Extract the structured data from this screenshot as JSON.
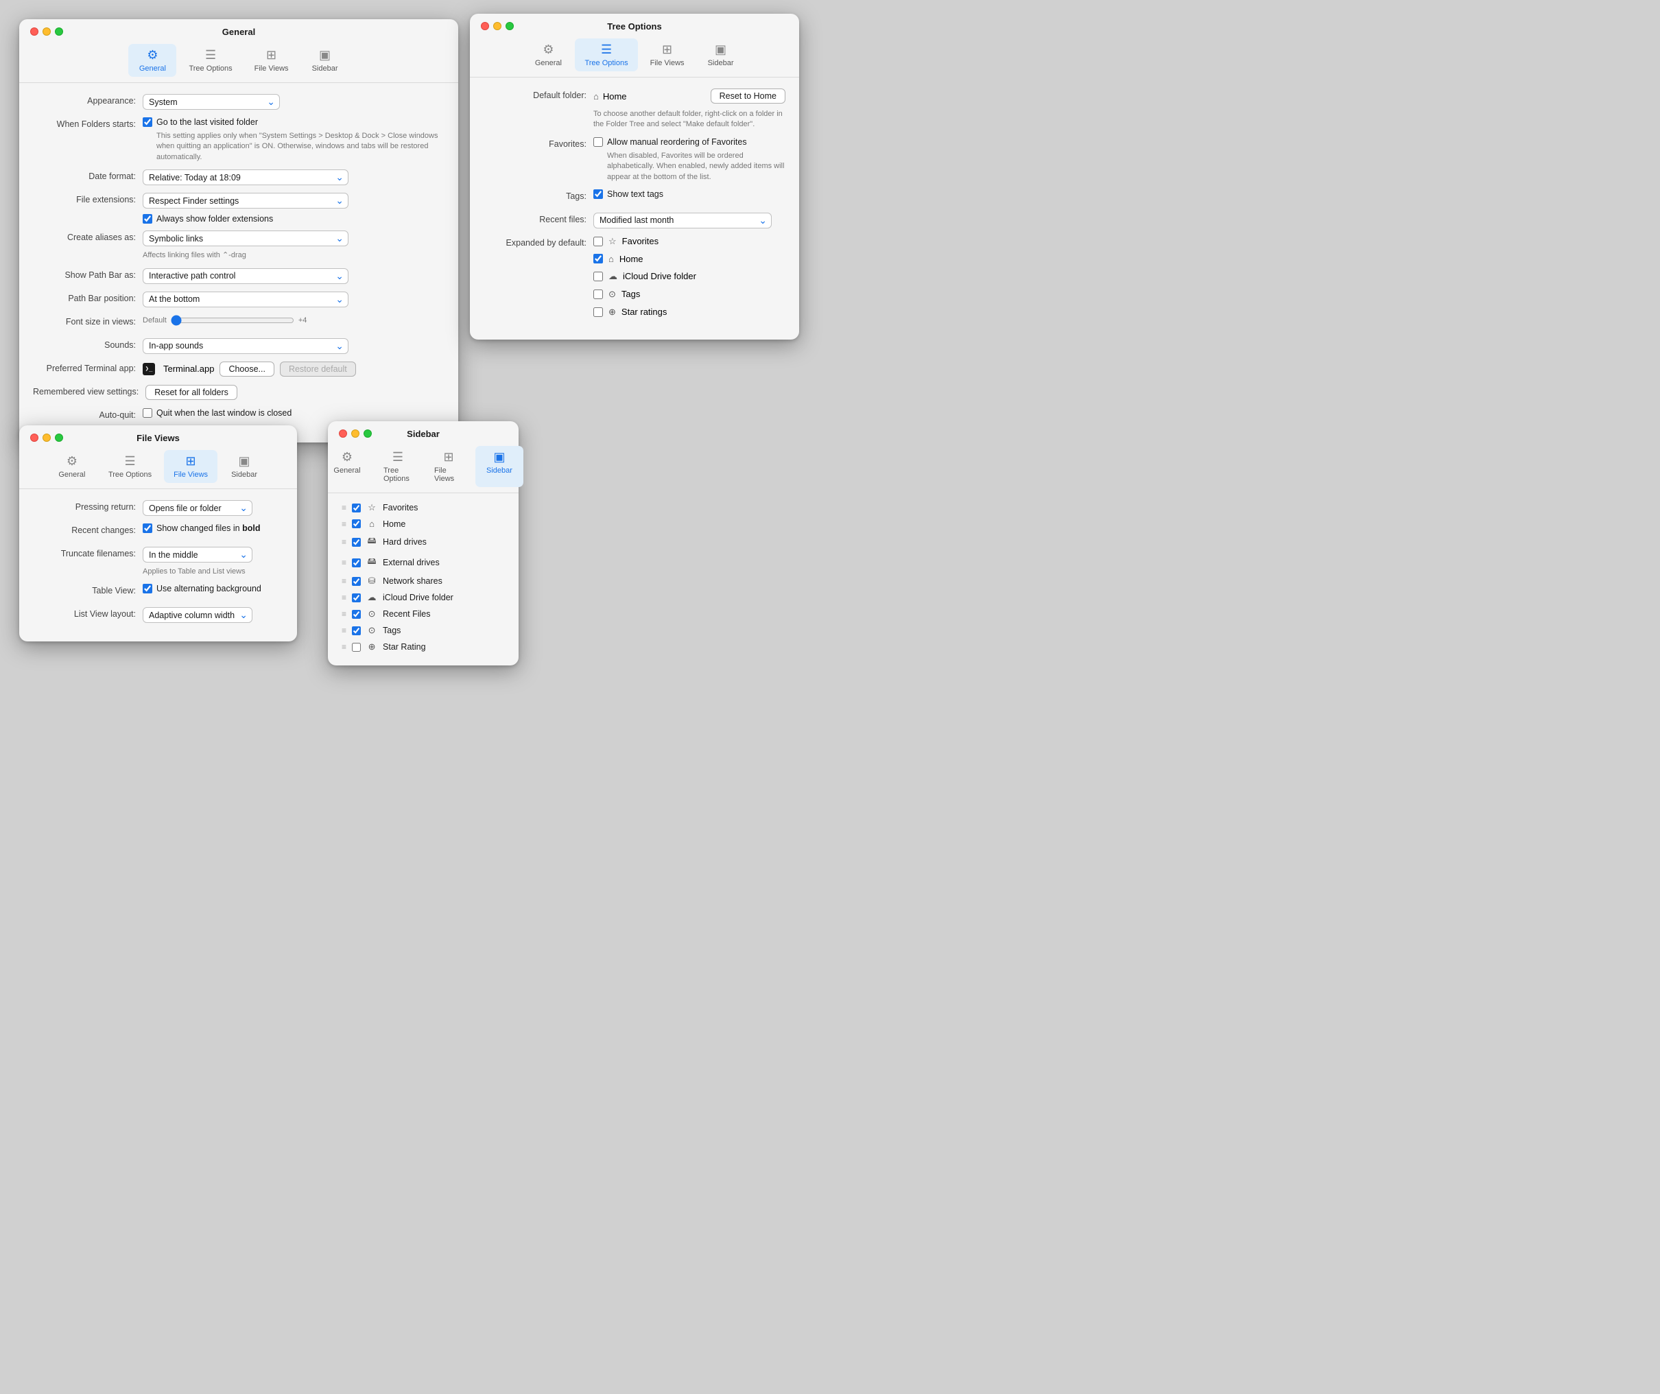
{
  "windows": {
    "general": {
      "title": "General",
      "tabs": [
        {
          "id": "general",
          "label": "General",
          "icon": "⚙️",
          "active": true
        },
        {
          "id": "tree",
          "label": "Tree Options",
          "icon": "≡",
          "active": false
        },
        {
          "id": "fileviews",
          "label": "File Views",
          "icon": "⊞",
          "active": false
        },
        {
          "id": "sidebar",
          "label": "Sidebar",
          "icon": "▣",
          "active": false
        }
      ],
      "fields": {
        "appearance_label": "Appearance:",
        "appearance_value": "System",
        "when_folders_label": "When Folders starts:",
        "when_folders_check": true,
        "when_folders_text": "Go to the last visited folder",
        "when_folders_help": "This setting applies only when \"System Settings > Desktop & Dock > Close windows when quitting an application\" is ON. Otherwise, windows and tabs will be restored automatically.",
        "date_format_label": "Date format:",
        "date_format_value": "Relative: Today at 18:09",
        "file_ext_label": "File extensions:",
        "file_ext_value": "Respect Finder settings",
        "always_show_ext_check": true,
        "always_show_ext_text": "Always show folder extensions",
        "create_aliases_label": "Create aliases as:",
        "create_aliases_value": "Symbolic links",
        "create_aliases_help": "Affects linking files with ⌃-drag",
        "show_pathbar_label": "Show Path Bar as:",
        "show_pathbar_value": "Interactive path control",
        "pathbar_pos_label": "Path Bar position:",
        "pathbar_pos_value": "At the bottom",
        "font_size_label": "Font size in views:",
        "font_size_min": "Default",
        "font_size_max": "+4",
        "sounds_label": "Sounds:",
        "sounds_value": "In-app sounds",
        "terminal_label": "Preferred Terminal app:",
        "terminal_name": "Terminal.app",
        "terminal_choose": "Choose...",
        "terminal_restore": "Restore default",
        "remembered_label": "Remembered view settings:",
        "remembered_value": "Reset for all folders",
        "autoquit_label": "Auto-quit:",
        "autoquit_check": false,
        "autoquit_text": "Quit when the last window is closed"
      }
    },
    "tree": {
      "title": "Tree Options",
      "tabs": [
        {
          "id": "general",
          "label": "General",
          "icon": "⚙️",
          "active": false
        },
        {
          "id": "tree",
          "label": "Tree Options",
          "icon": "≡",
          "active": true
        },
        {
          "id": "fileviews",
          "label": "File Views",
          "icon": "⊞",
          "active": false
        },
        {
          "id": "sidebar",
          "label": "Sidebar",
          "icon": "▣",
          "active": false
        }
      ],
      "fields": {
        "default_folder_label": "Default folder:",
        "default_folder_value": "Home",
        "reset_btn": "Reset to Home",
        "default_folder_help": "To choose another default folder, right-click on a folder in the Folder Tree and select \"Make default folder\".",
        "favorites_label": "Favorites:",
        "favorites_check": false,
        "favorites_text": "Allow manual reordering of Favorites",
        "favorites_help": "When disabled, Favorites will be ordered alphabetically. When enabled, newly added items will appear at the bottom of the list.",
        "tags_label": "Tags:",
        "tags_check": true,
        "tags_text": "Show text tags",
        "recent_files_label": "Recent files:",
        "recent_files_value": "Modified last month",
        "expanded_label": "Expanded by default:",
        "expanded_items": [
          {
            "id": "favorites",
            "checked": false,
            "icon": "☆",
            "label": "Favorites"
          },
          {
            "id": "home",
            "checked": true,
            "icon": "⌂",
            "label": "Home"
          },
          {
            "id": "icloud",
            "checked": false,
            "icon": "☁",
            "label": "iCloud Drive folder"
          },
          {
            "id": "tags",
            "checked": false,
            "icon": "⊙",
            "label": "Tags"
          },
          {
            "id": "starratings",
            "checked": false,
            "icon": "⊕",
            "label": "Star ratings"
          }
        ]
      }
    },
    "fileviews": {
      "title": "File Views",
      "tabs": [
        {
          "id": "general",
          "label": "General",
          "icon": "⚙️",
          "active": false
        },
        {
          "id": "tree",
          "label": "Tree Options",
          "icon": "≡",
          "active": false
        },
        {
          "id": "fileviews",
          "label": "File Views",
          "icon": "⊞",
          "active": true
        },
        {
          "id": "sidebar",
          "label": "Sidebar",
          "icon": "▣",
          "active": false
        }
      ],
      "fields": {
        "pressing_return_label": "Pressing return:",
        "pressing_return_value": "Opens file or folder",
        "recent_changes_label": "Recent changes:",
        "recent_changes_check": true,
        "recent_changes_text": "Show changed files in bold",
        "truncate_label": "Truncate filenames:",
        "truncate_value": "In the middle",
        "truncate_help": "Applies to Table and List views",
        "table_view_label": "Table View:",
        "table_view_check": true,
        "table_view_text": "Use alternating background",
        "list_layout_label": "List View layout:",
        "list_layout_value": "Adaptive column width"
      }
    },
    "sidebar": {
      "title": "Sidebar",
      "tabs": [
        {
          "id": "general",
          "label": "General",
          "icon": "⚙️",
          "active": false
        },
        {
          "id": "tree",
          "label": "Tree Options",
          "icon": "≡",
          "active": false
        },
        {
          "id": "fileviews",
          "label": "File Views",
          "icon": "⊞",
          "active": false
        },
        {
          "id": "sidebar",
          "label": "Sidebar",
          "icon": "▣",
          "active": true
        }
      ],
      "items": [
        {
          "id": "favorites",
          "checked": true,
          "icon": "☆",
          "label": "Favorites"
        },
        {
          "id": "home",
          "checked": true,
          "icon": "⌂",
          "label": "Home"
        },
        {
          "id": "harddrives",
          "checked": true,
          "icon": "🖥",
          "label": "Hard drives"
        },
        {
          "id": "external",
          "checked": true,
          "icon": "💾",
          "label": "External drives"
        },
        {
          "id": "network",
          "checked": true,
          "icon": "🔗",
          "label": "Network shares"
        },
        {
          "id": "icloud",
          "checked": true,
          "icon": "☁",
          "label": "iCloud Drive folder"
        },
        {
          "id": "recentfiles",
          "checked": true,
          "icon": "⊙",
          "label": "Recent Files"
        },
        {
          "id": "tags",
          "checked": true,
          "icon": "⊙",
          "label": "Tags"
        },
        {
          "id": "starrating",
          "checked": false,
          "icon": "⊕",
          "label": "Star Rating"
        }
      ]
    }
  }
}
